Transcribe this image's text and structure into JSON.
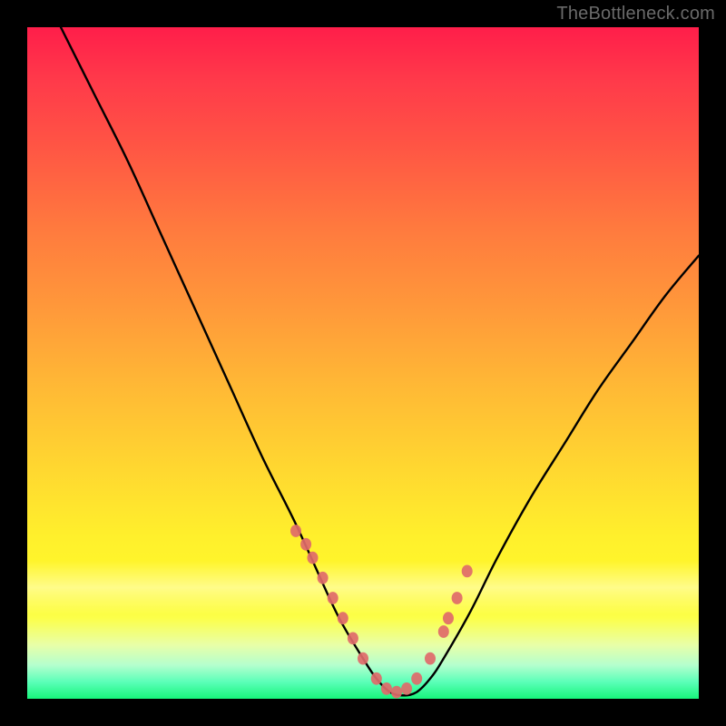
{
  "watermark": "TheBottleneck.com",
  "chart_data": {
    "type": "line",
    "title": "",
    "xlabel": "",
    "ylabel": "",
    "xlim": [
      0,
      100
    ],
    "ylim": [
      0,
      100
    ],
    "grid": false,
    "legend": false,
    "background_gradient": {
      "top": "#ff1e4a",
      "middle": "#ffd830",
      "bottom": "#17f57b"
    },
    "series": [
      {
        "name": "bottleneck-curve",
        "color": "#000000",
        "x": [
          5,
          10,
          15,
          20,
          25,
          30,
          35,
          40,
          45,
          47,
          50,
          52,
          54,
          56,
          58,
          60,
          62,
          66,
          70,
          75,
          80,
          85,
          90,
          95,
          100
        ],
        "y": [
          100,
          90,
          80,
          69,
          58,
          47,
          36,
          26,
          15,
          11,
          6,
          3,
          1,
          0.5,
          1,
          3,
          6,
          13,
          21,
          30,
          38,
          46,
          53,
          60,
          66
        ]
      }
    ],
    "markers": {
      "name": "highlight-dots",
      "color": "#e06a6a",
      "approx_radius_px": 6,
      "x": [
        40,
        41.5,
        42.5,
        44,
        45.5,
        47,
        48.5,
        50,
        52,
        53.5,
        55,
        56.5,
        58,
        60,
        62,
        62.7,
        64,
        65.5
      ],
      "y": [
        25,
        23,
        21,
        18,
        15,
        12,
        9,
        6,
        3,
        1.5,
        1,
        1.5,
        3,
        6,
        10,
        12,
        15,
        19
      ]
    }
  }
}
